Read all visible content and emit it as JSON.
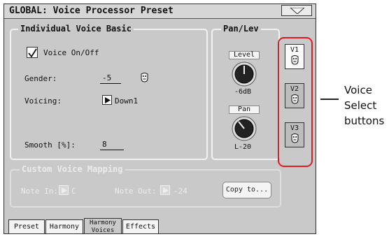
{
  "header": {
    "title": "GLOBAL: Voice Processor Preset"
  },
  "individual_voice_basic": {
    "title": "Individual Voice Basic",
    "voice_on_off_label": "Voice On/Off",
    "voice_on_off_checked": true,
    "gender_label": "Gender:",
    "gender_value": "-5",
    "voicing_label": "Voicing:",
    "voicing_value": "Down1",
    "smooth_label": "Smooth [%]:",
    "smooth_value": "8"
  },
  "pan_lev": {
    "title": "Pan/Lev",
    "level_label": "Level",
    "level_value": "-6dB",
    "pan_label": "Pan",
    "pan_value": "L-20"
  },
  "voice_select": {
    "buttons": [
      {
        "label": "V1",
        "active": true
      },
      {
        "label": "V2",
        "active": false
      },
      {
        "label": "V3",
        "active": false
      }
    ],
    "icon": "mask-icon"
  },
  "custom_voice_mapping": {
    "title": "Custom Voice Mapping",
    "note_in_label": "Note In:",
    "note_in_value": "C",
    "note_out_label": "Note Out:",
    "note_out_value": "-24",
    "copy_button": "Copy to..."
  },
  "tabs": [
    {
      "label": "Preset",
      "active": false
    },
    {
      "label_line1": "Harmony",
      "active": false
    },
    {
      "label_line1": "Harmony",
      "label_line2": "Voices",
      "active": true
    },
    {
      "label": "Effects",
      "active": false
    }
  ],
  "annotation": {
    "text": "Voice\nSelect\nbuttons",
    "color": "#e21a22"
  }
}
